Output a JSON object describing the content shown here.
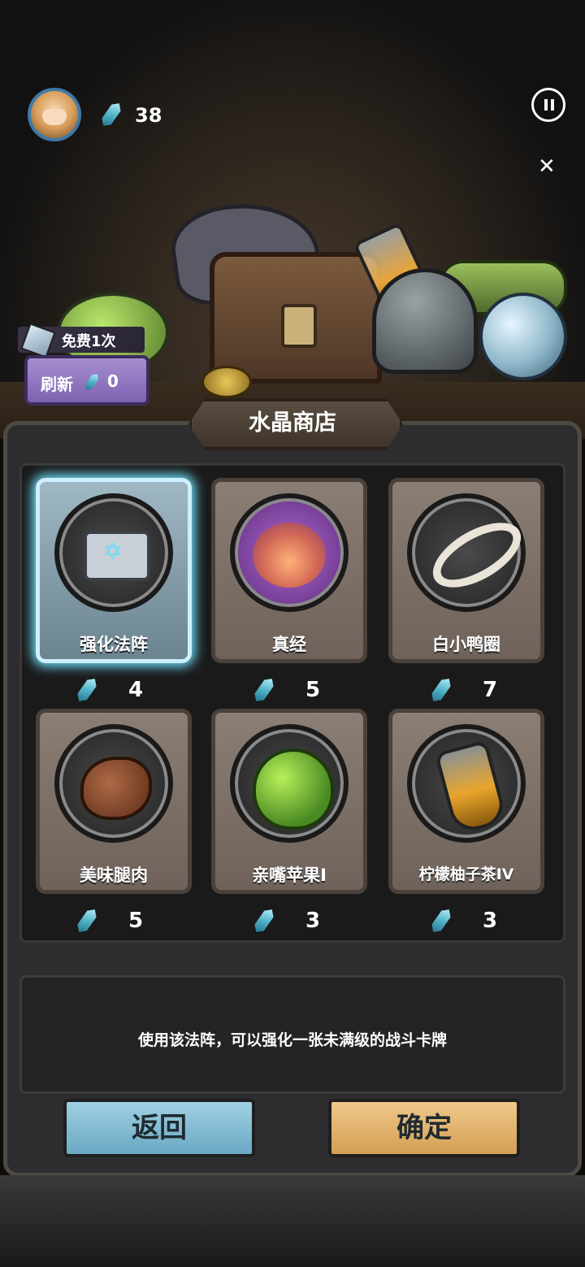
{
  "header": {
    "crystals": "38"
  },
  "refresh": {
    "free_label": "免费1次",
    "label": "刷新",
    "cost": "0"
  },
  "shop": {
    "title": "水晶商店",
    "items": [
      {
        "name": "强化法阵",
        "price": "4",
        "icon": "rune-circle-icon",
        "selected": true
      },
      {
        "name": "真经",
        "price": "5",
        "icon": "lotus-icon",
        "selected": false
      },
      {
        "name": "白小鸭圈",
        "price": "7",
        "icon": "ring-icon",
        "selected": false
      },
      {
        "name": "美味腿肉",
        "price": "5",
        "icon": "meat-icon",
        "selected": false
      },
      {
        "name": "亲嘴苹果I",
        "price": "3",
        "icon": "apple-icon",
        "selected": false
      },
      {
        "name": "柠檬柚子茶IV",
        "price": "3",
        "icon": "tea-bottle-icon",
        "selected": false
      }
    ]
  },
  "description": "使用该法阵，可以强化一张未满级的战斗卡牌",
  "buttons": {
    "back": "返回",
    "confirm": "确定"
  },
  "colors": {
    "accent_selected": "#6fe4ff",
    "back_button": "#6aa8c4",
    "confirm_button": "#d49e54"
  }
}
